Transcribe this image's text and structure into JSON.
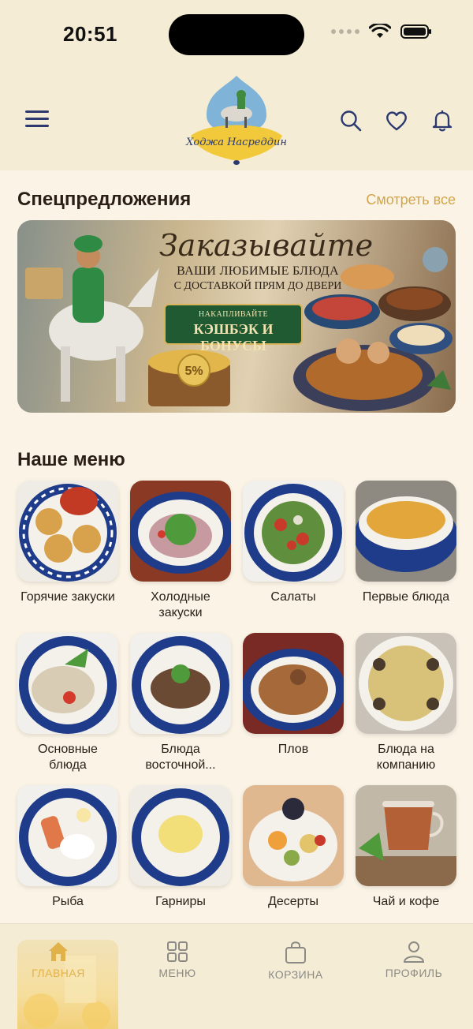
{
  "status": {
    "time": "20:51"
  },
  "header": {
    "logo_text": "Ходжа Насреддин",
    "icons": [
      "menu-icon",
      "search-icon",
      "heart-icon",
      "bell-icon"
    ]
  },
  "specials": {
    "title": "Спецпредложения",
    "see_all": "Смотреть все",
    "banner": {
      "headline": "Заказывайте",
      "line1": "ВАШИ ЛЮБИМЫЕ БЛЮДА",
      "line2": "С ДОСТАВКОЙ ПРЯМ ДО ДВЕРИ",
      "badge_top": "НАКАПЛИВАЙТЕ",
      "badge_main": "КЭШБЭК И БОНУСЫ",
      "percent": "5%"
    }
  },
  "menu": {
    "title": "Наше меню",
    "categories": [
      {
        "label": "Горячие закуски"
      },
      {
        "label": "Холодные закуски"
      },
      {
        "label": "Салаты"
      },
      {
        "label": "Первые блюда"
      },
      {
        "label": "Основные блюда"
      },
      {
        "label": "Блюда восточной..."
      },
      {
        "label": "Плов"
      },
      {
        "label": "Блюда на компанию"
      },
      {
        "label": "Рыба"
      },
      {
        "label": "Гарниры"
      },
      {
        "label": "Десерты"
      },
      {
        "label": "Чай и кофе"
      }
    ]
  },
  "tabbar": {
    "tabs": [
      {
        "label": "ГЛАВНАЯ",
        "icon": "home-icon",
        "active": true
      },
      {
        "label": "МЕНЮ",
        "icon": "grid-icon",
        "active": false
      },
      {
        "label": "КОРЗИНА",
        "icon": "bag-icon",
        "active": false
      },
      {
        "label": "ПРОФИЛЬ",
        "icon": "user-icon",
        "active": false
      }
    ]
  },
  "colors": {
    "accent": "#d3a54a",
    "icon_blue": "#2b3970",
    "header_bg": "#f4ecd4",
    "page_bg": "#fbf4e6"
  }
}
